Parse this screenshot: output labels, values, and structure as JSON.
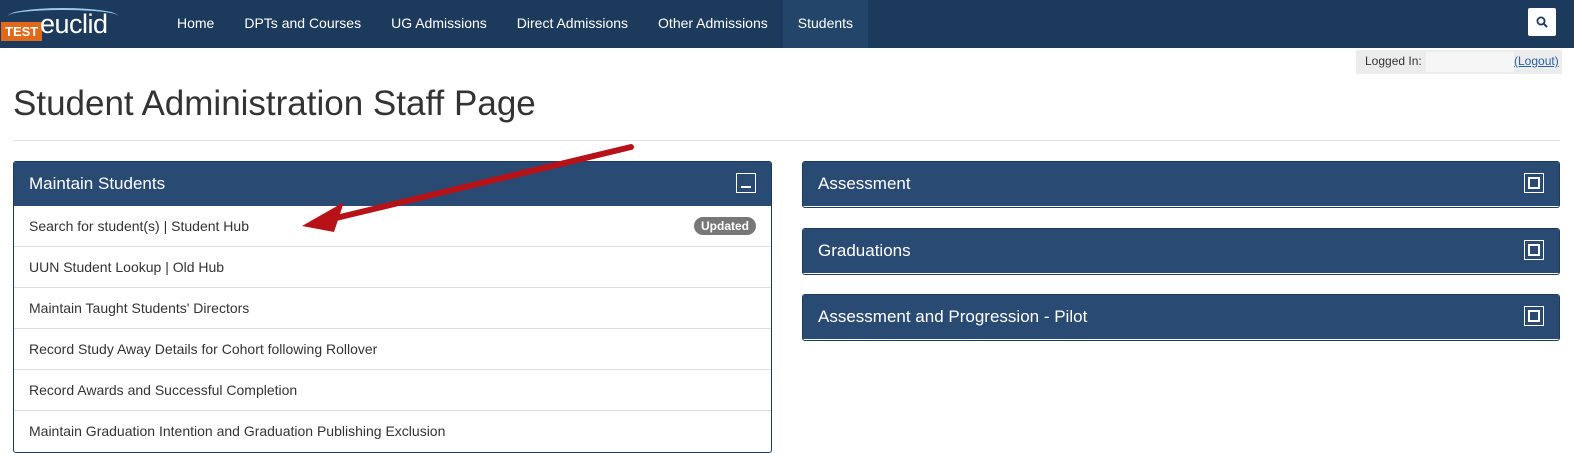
{
  "header": {
    "logo_test": "TEST",
    "logo_euclid": "euclid",
    "nav": [
      {
        "label": "Home",
        "active": false
      },
      {
        "label": "DPTs and Courses",
        "active": false
      },
      {
        "label": "UG Admissions",
        "active": false
      },
      {
        "label": "Direct Admissions",
        "active": false
      },
      {
        "label": "Other Admissions",
        "active": false
      },
      {
        "label": "Students",
        "active": true
      }
    ],
    "search_icon": "search-icon"
  },
  "login": {
    "label": "Logged In:",
    "logout": "(Logout)"
  },
  "page": {
    "title": "Student Administration Staff Page"
  },
  "maintain_students": {
    "title": "Maintain Students",
    "items": [
      {
        "label": "Search for student(s) | Student Hub",
        "badge": "Updated"
      },
      {
        "label": "UUN Student Lookup | Old Hub"
      },
      {
        "label": "Maintain Taught Students' Directors"
      },
      {
        "label": "Record Study Away Details for Cohort following Rollover"
      },
      {
        "label": "Record Awards and Successful Completion"
      },
      {
        "label": "Maintain Graduation Intention and Graduation Publishing Exclusion"
      }
    ]
  },
  "right_panels": [
    {
      "title": "Assessment"
    },
    {
      "title": "Graduations"
    },
    {
      "title": "Assessment and Progression - Pilot"
    }
  ],
  "colors": {
    "navbar": "#1c3a5c",
    "panel_header": "#294a72",
    "annotation_arrow": "#c0141b"
  }
}
